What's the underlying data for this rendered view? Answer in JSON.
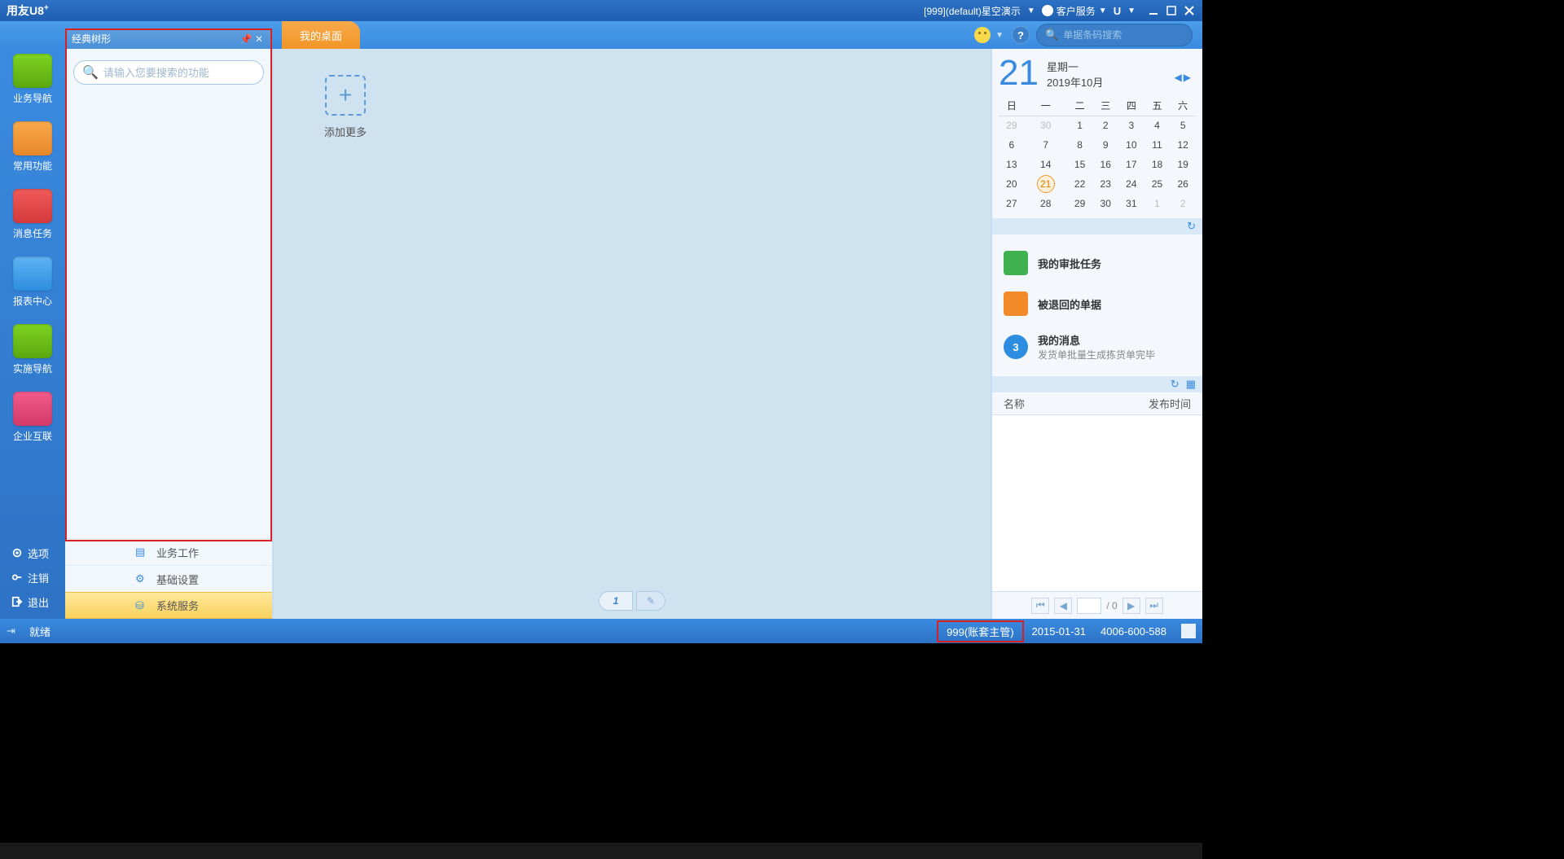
{
  "titlebar": {
    "brand": "用友U8",
    "brand_sup": "+",
    "account_info": "[999](default)星空演示",
    "customer_service": "客户服务",
    "u_label": "U"
  },
  "header": {
    "desktop_tab": "我的桌面",
    "search_placeholder": "单据条码搜索"
  },
  "leftnav": {
    "items": [
      {
        "label": "业务导航",
        "cls": "green"
      },
      {
        "label": "常用功能",
        "cls": "orange"
      },
      {
        "label": "消息任务",
        "cls": "red"
      },
      {
        "label": "报表中心",
        "cls": "blue"
      },
      {
        "label": "实施导航",
        "cls": "green2"
      },
      {
        "label": "企业互联",
        "cls": "pink"
      }
    ],
    "bottom": [
      {
        "label": "选项"
      },
      {
        "label": "注销"
      },
      {
        "label": "退出"
      }
    ]
  },
  "tree": {
    "title": "经典树形",
    "search_placeholder": "请输入您要搜索的功能",
    "cats": [
      {
        "label": "业务工作",
        "active": false
      },
      {
        "label": "基础设置",
        "active": false
      },
      {
        "label": "系统服务",
        "active": true
      }
    ]
  },
  "desktop": {
    "add_more": "添加更多",
    "page_current": "1"
  },
  "calendar": {
    "day": "21",
    "weekday": "星期一",
    "year_month": "2019年10月",
    "dow": [
      "日",
      "一",
      "二",
      "三",
      "四",
      "五",
      "六"
    ],
    "rows": [
      [
        {
          "v": "29",
          "dim": true
        },
        {
          "v": "30",
          "dim": true
        },
        {
          "v": "1"
        },
        {
          "v": "2"
        },
        {
          "v": "3"
        },
        {
          "v": "4"
        },
        {
          "v": "5"
        }
      ],
      [
        {
          "v": "6"
        },
        {
          "v": "7"
        },
        {
          "v": "8"
        },
        {
          "v": "9"
        },
        {
          "v": "10"
        },
        {
          "v": "11"
        },
        {
          "v": "12"
        }
      ],
      [
        {
          "v": "13"
        },
        {
          "v": "14"
        },
        {
          "v": "15"
        },
        {
          "v": "16"
        },
        {
          "v": "17"
        },
        {
          "v": "18"
        },
        {
          "v": "19"
        }
      ],
      [
        {
          "v": "20"
        },
        {
          "v": "21",
          "today": true
        },
        {
          "v": "22"
        },
        {
          "v": "23"
        },
        {
          "v": "24"
        },
        {
          "v": "25"
        },
        {
          "v": "26"
        }
      ],
      [
        {
          "v": "27"
        },
        {
          "v": "28"
        },
        {
          "v": "29"
        },
        {
          "v": "30"
        },
        {
          "v": "31"
        },
        {
          "v": "1",
          "dim": true
        },
        {
          "v": "2",
          "dim": true
        }
      ]
    ]
  },
  "tasks": {
    "approval": "我的审批任务",
    "returned": "被退回的单据",
    "messages_title": "我的消息",
    "messages_sub": "发货单批量生成拣货单完毕",
    "messages_count": "3"
  },
  "news": {
    "col_name": "名称",
    "col_time": "发布时间"
  },
  "news_pager": {
    "total_suffix": "/ 0"
  },
  "statusbar": {
    "ready": "就绪",
    "account": "999(账套主管)",
    "date": "2015-01-31",
    "phone": "4006-600-588"
  }
}
